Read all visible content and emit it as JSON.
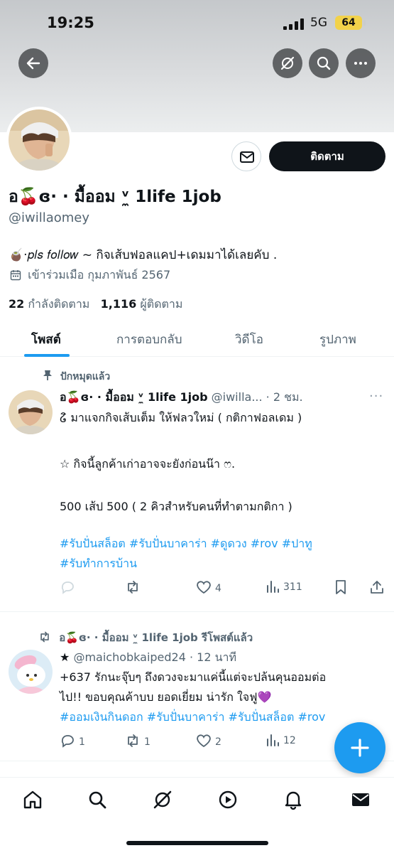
{
  "status_bar": {
    "time": "19:25",
    "network": "5G",
    "battery": "64"
  },
  "header": {
    "back_icon": "arrow-left-icon",
    "grok_icon": "slash-circle-icon",
    "search_icon": "search-icon",
    "more_icon": "more-icon"
  },
  "profile": {
    "name": "อ🍒ɞ·  · มื้ออม ᵛ̼ 1life 1job",
    "handle": "@iwillaomey",
    "bio": "🧉·𝑝𝑙𝑠 𝑓𝑜𝑙𝑙𝑜𝑤 ~ กิจเส้บฟอลแคป+เดมมาได้เลยคับ .",
    "joined": "เข้าร่วมเมือ กุมภาพันธ์ 2567",
    "following_count": "22",
    "following_label": "กำลังติดตาม",
    "followers_count": "1,116",
    "followers_label": "ผู้ติดตาม",
    "follow_button": "ติดตาม"
  },
  "tabs": [
    {
      "label": "โพสต์",
      "active": true
    },
    {
      "label": "การตอบกลับ",
      "active": false
    },
    {
      "label": "วิดีโอ",
      "active": false
    },
    {
      "label": "รูปภาพ",
      "active": false
    }
  ],
  "pinned_label": "ปักหมุดแล้ว",
  "tweet1": {
    "name": "อ🍒ɞ·  · มื้ออม ᵛ̼ 1life 1job",
    "handle": "@iwilla...",
    "time": "· 2 ชม.",
    "line1": "໒ิ มาแจกกิจเส้บเต็ม ให้ฟลวใหม่ ( กติกาฟอลเดม )",
    "line2": "☆ กิจนี้ลูกค้าเก่าอาจจะยังก่อนน๊า ෆ.",
    "line3": "500 เส้ป 500 ( 2 คิวสำหรับคนที่ทำตามกติกา )",
    "tags1": "#รับปั่นสล็อต #รับปั่นบาคาร่า #ดูดวง #rov #ปาทู",
    "tags2": "#รับทำการบ้าน",
    "likes": "4",
    "views": "311"
  },
  "retweet_label": "อ🍒ɞ·  · มื้ออม ᵛ̼ 1life 1job รีโพสต์แล้ว",
  "tweet2": {
    "name": "★",
    "handle": "@maichobkaiped24",
    "time": "· 12 นาที",
    "line1": "+637 รักนะจุ๊บๆ ถึงดวงจะมาแค่นี้แต่จะปล้นคุนออมต่อ",
    "line2": "ไป!!  ขอบคุณค้าบบ ยอดเยี่ยม น่ารัก  ใจฟู💜",
    "tags": "#ออมเงินกินดอก #รับปั่นบาคาร่า #รับปั่นสล็อต #rov",
    "replies": "1",
    "retweets": "1",
    "likes": "2",
    "views": "12"
  },
  "colors": {
    "accent": "#1d9bf0",
    "text": "#0f1419",
    "muted": "#536471"
  }
}
